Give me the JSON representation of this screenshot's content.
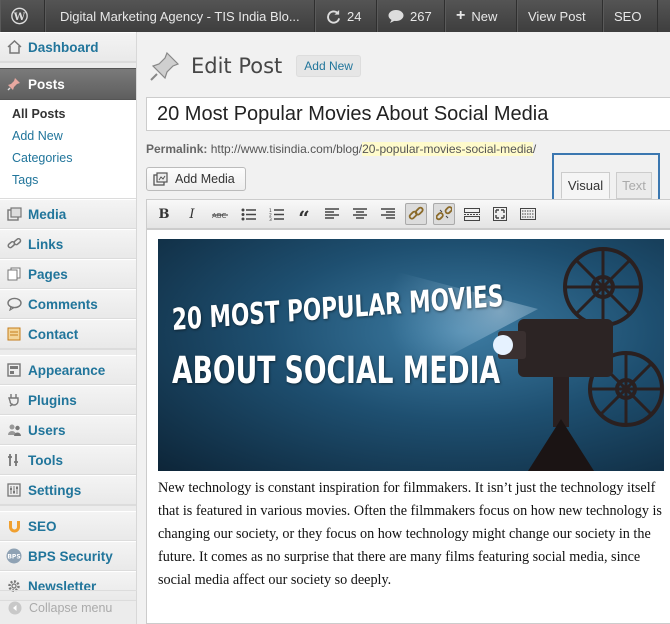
{
  "adminbar": {
    "site_title": "Digital Marketing Agency - TIS India Blo...",
    "updates_count": "24",
    "comments_count": "267",
    "new_label": "New",
    "view_post_label": "View Post",
    "seo_label": "SEO"
  },
  "sidebar": {
    "dashboard": "Dashboard",
    "posts": "Posts",
    "posts_sub": [
      "All Posts",
      "Add New",
      "Categories",
      "Tags"
    ],
    "media": "Media",
    "links": "Links",
    "pages": "Pages",
    "comments": "Comments",
    "contact": "Contact",
    "appearance": "Appearance",
    "plugins": "Plugins",
    "users": "Users",
    "tools": "Tools",
    "settings": "Settings",
    "seo": "SEO",
    "bps_security": "BPS Security",
    "newsletter": "Newsletter",
    "collapse": "Collapse menu"
  },
  "main": {
    "heading": "Edit Post",
    "add_new": "Add New",
    "post_title": "20 Most Popular Movies About Social Media",
    "permalink_label": "Permalink:",
    "permalink_base": "http://www.tisindia.com/blog/",
    "permalink_slug": "20-popular-movies-social-media",
    "permalink_trail": "/",
    "add_media": "Add Media",
    "tab_visual": "Visual",
    "tab_text": "Text"
  },
  "editor": {
    "banner_line1": "20 MOST POPULAR MOVIES",
    "banner_line2": "ABOUT SOCIAL MEDIA",
    "paragraph": "New technology is constant inspiration for filmmakers. It isn’t just the technology itself that is featured in various movies. Often the filmmakers focus on how new technology is changing our society, or they focus on how technology might change our society in the future. It comes as no surprise that there are many films featuring social media, since social media affect our society so deeply."
  },
  "toolbar_icons": [
    "bold-icon",
    "italic-icon",
    "strikethrough-icon",
    "bullet-list-icon",
    "numbered-list-icon",
    "blockquote-icon",
    "align-left-icon",
    "align-center-icon",
    "align-right-icon",
    "insert-link-icon",
    "unlink-icon",
    "read-more-icon",
    "fullscreen-icon",
    "kitchen-sink-icon"
  ],
  "colors": {
    "link": "#21759b",
    "admin_bar": "#464646",
    "active_menu": "#6d6d6d",
    "highlight_box": "#3b77b0"
  }
}
